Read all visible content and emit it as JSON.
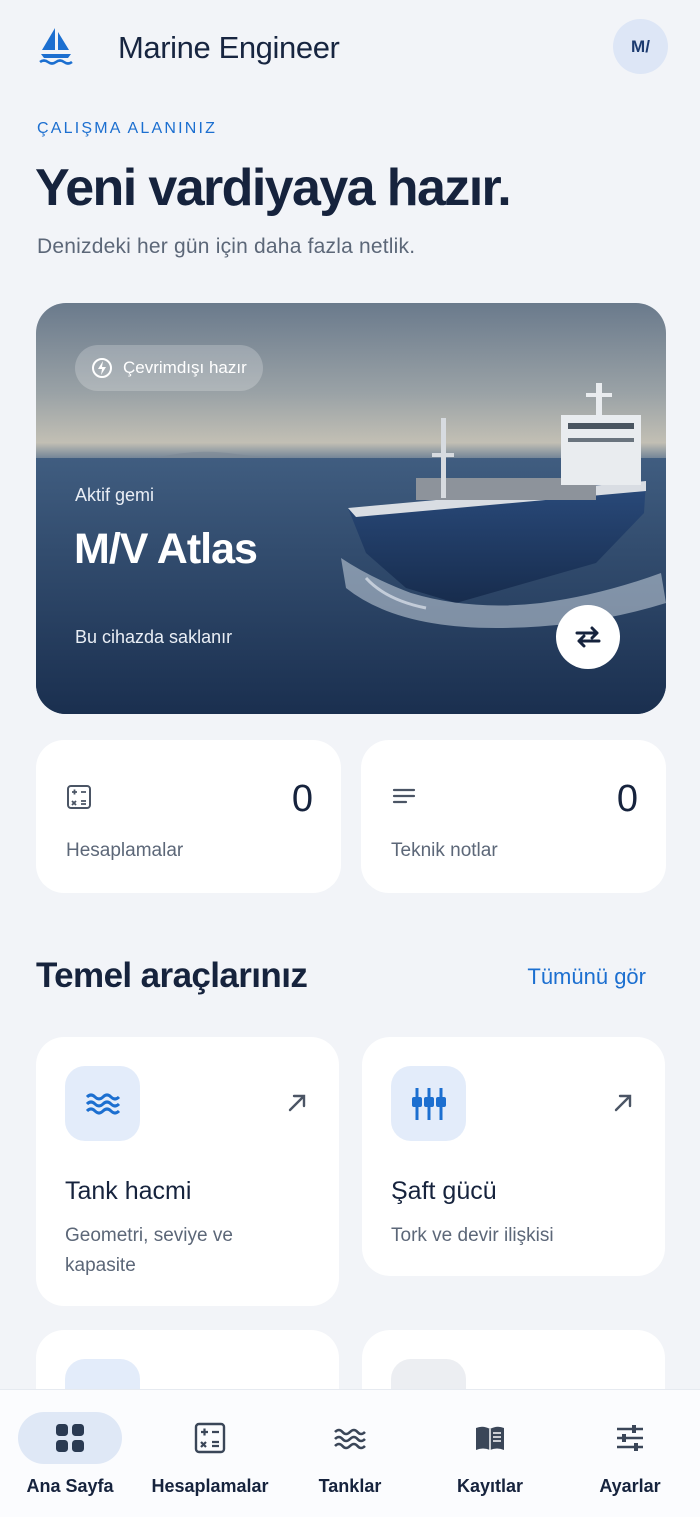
{
  "header": {
    "app_title": "Marine Engineer",
    "avatar_initials": "M/",
    "logo_icon": "sailboat-icon"
  },
  "intro": {
    "eyebrow": "ÇALIŞMA ALANINIZ",
    "headline": "Yeni vardiyaya hazır.",
    "subline": "Denizdeki her gün için daha fazla netlik."
  },
  "hero": {
    "badge_label": "Çevrimdışı hazır",
    "badge_icon": "bolt-icon",
    "label": "Aktif gemi",
    "ship_name": "M/V Atlas",
    "note": "Bu cihazda saklanır",
    "swap_icon": "swap-arrows-icon"
  },
  "stats": [
    {
      "value": "0",
      "label": "Hesaplamalar",
      "icon": "calculator-icon"
    },
    {
      "value": "0",
      "label": "Teknik notlar",
      "icon": "notes-icon"
    }
  ],
  "tools_section": {
    "title": "Temel araçlarınız",
    "see_all": "Tümünü gör"
  },
  "tools": [
    {
      "title": "Tank hacmi",
      "desc": "Geometri, seviye ve kapasite",
      "icon": "waves-icon"
    },
    {
      "title": "Şaft gücü",
      "desc": "Tork ve devir ilişkisi",
      "icon": "shaft-icon"
    }
  ],
  "bottom_nav": [
    {
      "label": "Ana Sayfa",
      "icon": "grid-icon",
      "active": true
    },
    {
      "label": "Hesaplamalar",
      "icon": "calculator-icon"
    },
    {
      "label": "Tanklar",
      "icon": "waves-icon"
    },
    {
      "label": "Kayıtlar",
      "icon": "book-icon"
    },
    {
      "label": "Ayarlar",
      "icon": "sliders-icon"
    }
  ],
  "colors": {
    "accent": "#1c6fd0",
    "text": "#16233d",
    "muted": "#5c6778",
    "background": "#f2f4f8"
  }
}
